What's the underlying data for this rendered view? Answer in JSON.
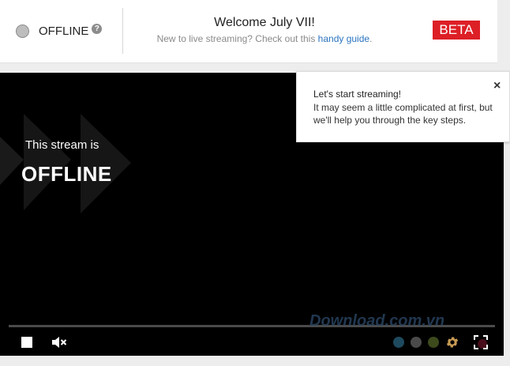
{
  "header": {
    "status_label": "OFFLINE",
    "help_symbol": "?",
    "welcome_title": "Welcome July VII!",
    "welcome_sub_prefix": "New to live streaming? Check out this ",
    "guide_link": "handy guide",
    "welcome_sub_suffix": ".",
    "beta_label": "BETA"
  },
  "player": {
    "stream_is": "This stream is",
    "offline_big": "OFFLINE",
    "progress_fraction": 0,
    "quality_colors": [
      "#1d4a5e",
      "#4a4a4a",
      "#3c4a1c",
      "#13374f"
    ],
    "watermark": "Download.com.vn"
  },
  "tooltip": {
    "title": "Let's start streaming!",
    "body": "It may seem a little complicated at first, but we'll help you through the key steps.",
    "close_symbol": "×"
  },
  "colors": {
    "beta_red": "#dd1f26",
    "link_blue": "#2a74c0",
    "gear_gold": "#c79a54"
  }
}
